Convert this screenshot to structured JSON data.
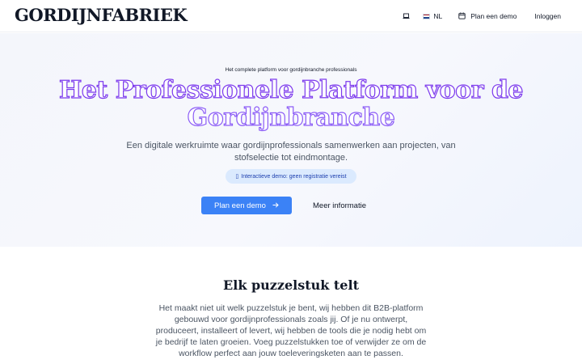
{
  "navbar": {
    "logo": "GORDIJNFABRIEK",
    "language": "NL",
    "demo_link": "Plan een demo",
    "login": "Inloggen"
  },
  "hero": {
    "badge": "Het complete platform voor gordijnbranche professionals",
    "title_line1": "Het Professionele Platform voor de",
    "title_line2": "Gordijnbranche",
    "subtitle": "Een digitale werkruimte waar gordijnprofessionals samenwerken aan projecten, van stofselectie tot eindmontage.",
    "demo_pill_icon": "▯",
    "demo_pill": "Interactieve demo: geen registratie vereist",
    "primary_button": "Plan een demo",
    "secondary_button": "Meer informatie"
  },
  "section": {
    "title": "Elk puzzelstuk telt",
    "text": "Het maakt niet uit welk puzzelstuk je bent, wij hebben dit B2B-platform gebouwd voor gordijnprofessionals zoals jij. Of je nu ontwerpt, produceert, installeert of levert, wij hebben de tools die je nodig hebt om je bedrijf te laten groeien. Voeg puzzelstukken toe of verwijder ze om de workflow perfect aan jouw toeleveringsketen aan te passen."
  },
  "colors": {
    "accent": "#3b82f6",
    "title_stroke": "#7c3aed",
    "pill_bg": "#dbeafe"
  },
  "icons": {
    "theme": "laptop-icon",
    "flag": "netherlands-flag-icon",
    "calendar": "calendar-icon",
    "arrow": "arrow-right-icon"
  }
}
